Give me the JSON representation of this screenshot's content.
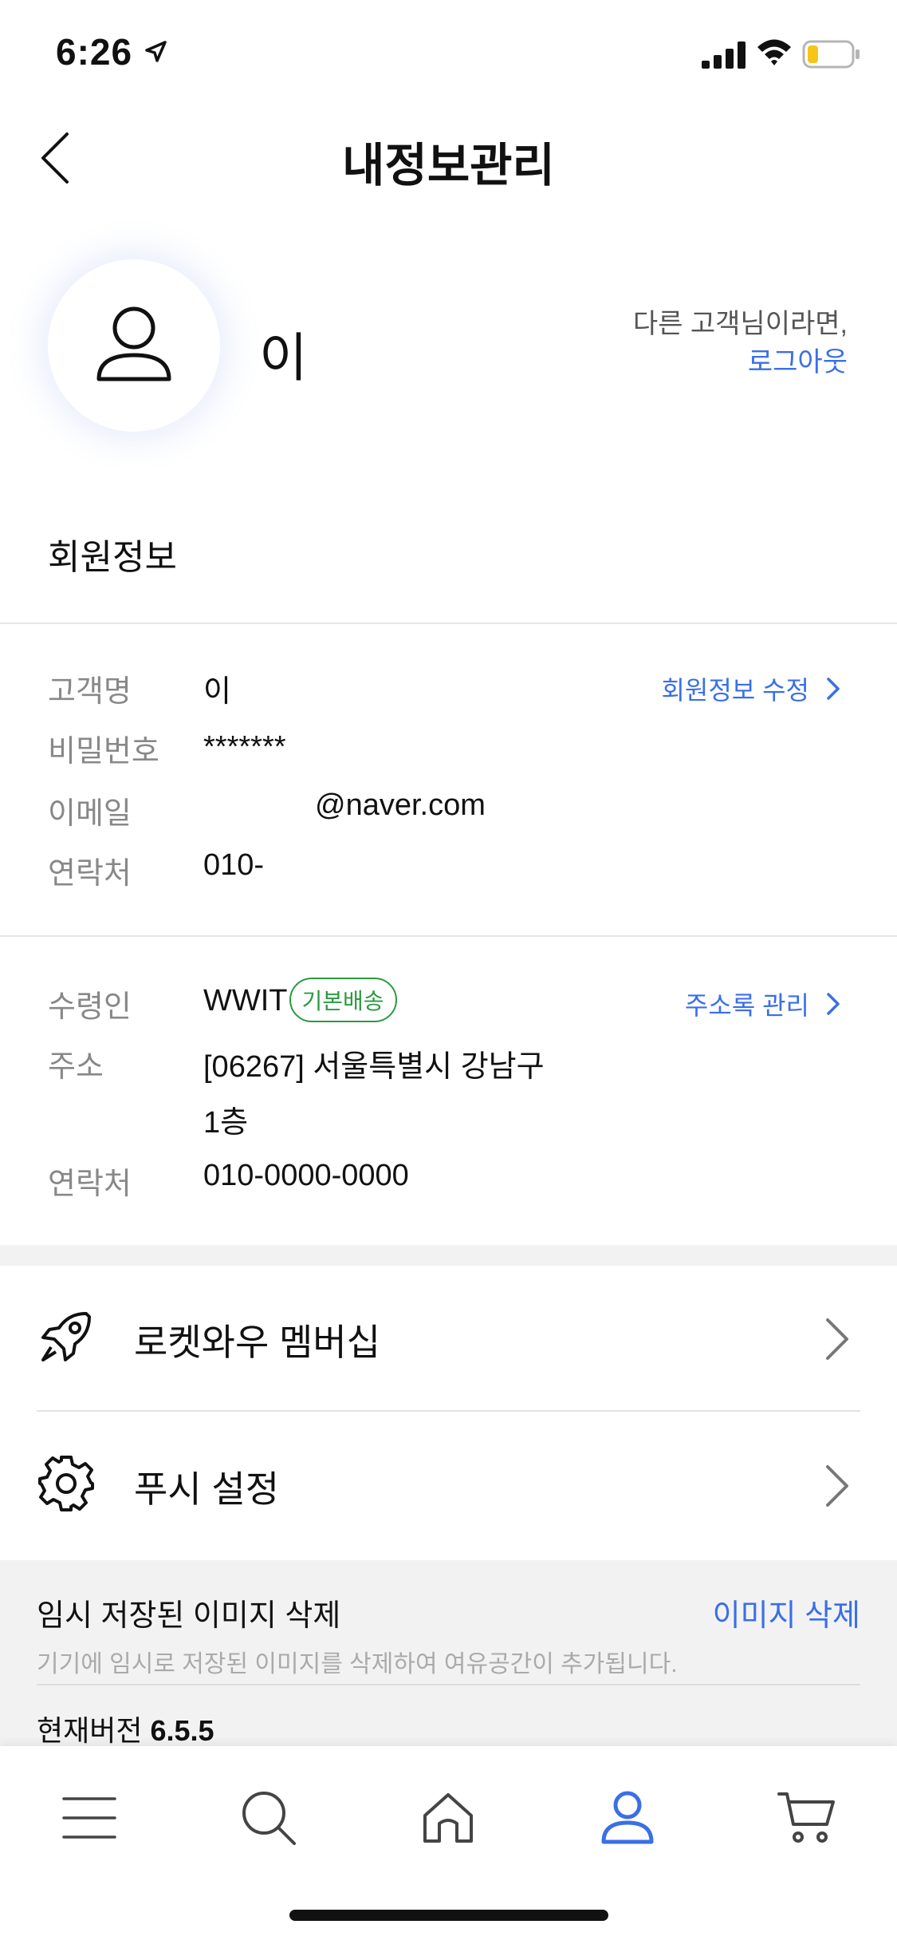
{
  "status_bar": {
    "time": "6:26"
  },
  "header": {
    "title": "내정보관리"
  },
  "profile": {
    "name": "이",
    "other_user_text": "다른 고객님이라면,",
    "logout_label": "로그아웃"
  },
  "member_section": {
    "title": "회원정보",
    "edit_link": "회원정보 수정",
    "fields": [
      {
        "label": "고객명",
        "value": "이"
      },
      {
        "label": "비밀번호",
        "value": "*******"
      },
      {
        "label": "이메일",
        "value": "@naver.com"
      },
      {
        "label": "연락처",
        "value": "010-"
      }
    ]
  },
  "address_section": {
    "manage_link": "주소록 관리",
    "recipient_label": "수령인",
    "recipient_value": "WWIT",
    "default_badge": "기본배송",
    "address_label": "주소",
    "address_line1": "[06267] 서울특별시 강남구",
    "address_line2": "1층",
    "phone_label": "연락처",
    "phone_value": "010-0000-0000"
  },
  "menu": [
    {
      "label": "로켓와우 멤버십",
      "icon": "rocket-icon"
    },
    {
      "label": "푸시 설정",
      "icon": "gear-icon"
    }
  ],
  "cache": {
    "title": "임시 저장된 이미지 삭제",
    "action": "이미지 삭제",
    "description": "기기에 임시로 저장된 이미지를 삭제하여 여유공간이 추가됩니다."
  },
  "version": {
    "label": "현재버전",
    "value": "6.5.5"
  },
  "tabbar": {
    "tabs": [
      {
        "icon": "menu-icon"
      },
      {
        "icon": "search-icon"
      },
      {
        "icon": "home-icon"
      },
      {
        "icon": "profile-icon",
        "active": true
      },
      {
        "icon": "cart-icon"
      }
    ],
    "active_color": "#3a6fe6"
  },
  "colors": {
    "link": "#3a6fe6",
    "badge": "#2b9a3f",
    "battery": "#f5c518"
  }
}
